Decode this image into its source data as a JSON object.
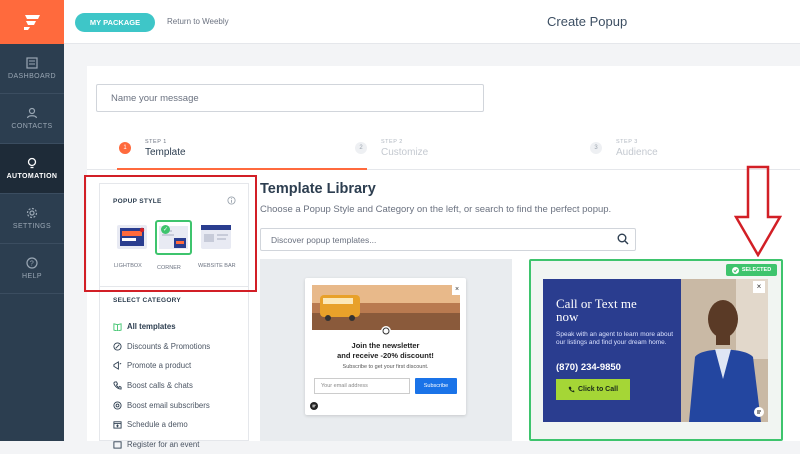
{
  "sidebar": {
    "items": [
      {
        "label": "DASHBOARD",
        "icon": "dashboard-icon"
      },
      {
        "label": "CONTACTS",
        "icon": "contacts-icon"
      },
      {
        "label": "AUTOMATION",
        "icon": "lightbulb-icon",
        "active": true
      },
      {
        "label": "SETTINGS",
        "icon": "gear-icon"
      },
      {
        "label": "HELP",
        "icon": "help-icon"
      }
    ]
  },
  "topbar": {
    "package_button": "MY PACKAGE",
    "return_link": "Return to Weebly",
    "title": "Create Popup"
  },
  "form": {
    "name_placeholder": "Name your message"
  },
  "steps": [
    {
      "num": "1",
      "sub": "STEP 1",
      "label": "Template",
      "active": true
    },
    {
      "num": "2",
      "sub": "STEP 2",
      "label": "Customize"
    },
    {
      "num": "3",
      "sub": "STEP 3",
      "label": "Audience"
    }
  ],
  "popup_style": {
    "title": "POPUP STYLE",
    "options": [
      "LIGHTBOX",
      "CORNER",
      "WEBSITE BAR"
    ],
    "selected": "CORNER"
  },
  "category": {
    "title": "SELECT CATEGORY",
    "items": [
      {
        "label": "All templates",
        "icon": "book-icon",
        "active": true
      },
      {
        "label": "Discounts & Promotions",
        "icon": "percent-icon"
      },
      {
        "label": "Promote a product",
        "icon": "megaphone-icon"
      },
      {
        "label": "Boost calls & chats",
        "icon": "phone-icon"
      },
      {
        "label": "Boost email subscribers",
        "icon": "at-icon"
      },
      {
        "label": "Schedule a demo",
        "icon": "calendar-icon"
      },
      {
        "label": "Register for an event",
        "icon": "ticket-icon"
      }
    ]
  },
  "library": {
    "title": "Template Library",
    "subtitle": "Choose a Popup Style and Category on the left, or search to find the perfect popup.",
    "search_placeholder": "Discover popup templates..."
  },
  "template1": {
    "heading_line1": "Join the newsletter",
    "heading_line2": "and receive -20% discount!",
    "subtext": "Subscribe to get your first discount.",
    "email_placeholder": "Your email address",
    "button": "Subscribe",
    "close": "×"
  },
  "template2": {
    "badge": "SELECTED",
    "heading_line1": "Call or Text me",
    "heading_line2": "now",
    "text": "Speak with an agent to learn more about our listings and find your dream home.",
    "phone": "(870) 234-9850",
    "button": "Click to Call",
    "close": "×"
  },
  "colors": {
    "brand": "#ff6a3d",
    "sidebar": "#2c3e50",
    "teal": "#3ec6c8",
    "selected": "#3ec46d",
    "annotation_red": "#d21f26"
  }
}
